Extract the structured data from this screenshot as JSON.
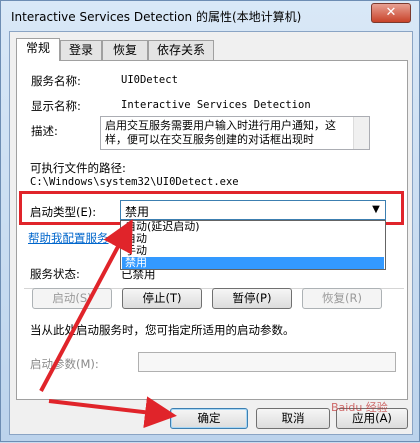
{
  "window": {
    "title": "Interactive Services Detection 的属性(本地计算机)",
    "close_glyph": "✕"
  },
  "tabs": [
    {
      "label": "常规",
      "active": true
    },
    {
      "label": "登录",
      "active": false
    },
    {
      "label": "恢复",
      "active": false
    },
    {
      "label": "依存关系",
      "active": false
    }
  ],
  "general": {
    "service_name_label": "服务名称:",
    "service_name_value": "UI0Detect",
    "display_name_label": "显示名称:",
    "display_name_value": "Interactive Services Detection",
    "description_label": "描述:",
    "description_text": "启用交互服务需要用户输入时进行用户通知，这样，便可以在交互服务创建的对话框出现时",
    "path_label": "可执行文件的路径:",
    "path_value": "C:\\Windows\\system32\\UI0Detect.exe",
    "startup_type_label": "启动类型(E):",
    "startup_type_value": "禁用",
    "startup_options": [
      "自动(延迟启动)",
      "自动",
      "手动",
      "禁用"
    ],
    "help_link": "帮助我配置服务",
    "status_label": "服务状态:",
    "status_value": "已禁用",
    "buttons": {
      "start": "启动(S)",
      "stop": "停止(T)",
      "pause": "暂停(P)",
      "resume": "恢复(R)"
    },
    "hint": "当从此处启动服务时，您可指定所适用的启动参数。",
    "param_label": "启动参数(M):",
    "param_value": ""
  },
  "footer": {
    "ok": "确定",
    "cancel": "取消",
    "apply": "应用(A)"
  },
  "watermark": "Baidu 经验",
  "colors": {
    "highlight": "#e0242a",
    "selection": "#3399ff",
    "link": "#0066cc"
  }
}
